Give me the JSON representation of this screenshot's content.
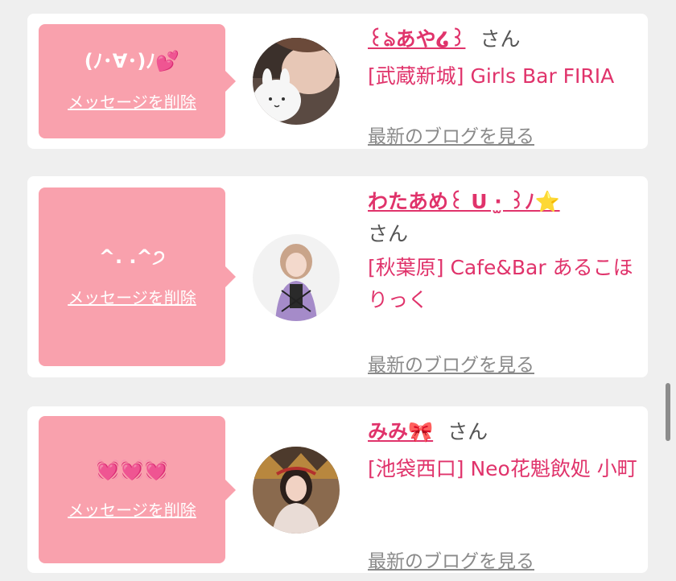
{
  "cards": [
    {
      "message": "(ﾉ･∀･)ﾉ💕",
      "delete_label": "メッセージを削除",
      "name": "꒰ঌあや໒꒱",
      "honorific": "さん",
      "shop": "[武蔵新城] Girls Bar FIRIA",
      "blog_label": "最新のブログを見る"
    },
    {
      "message": "^. .^੭",
      "delete_label": "メッセージを削除",
      "name": "わたあめ꒰ U ·̫ ꒱ﾉ⭐",
      "honorific": "さん",
      "shop": "[秋葉原] Cafe&Bar あるこほりっく",
      "blog_label": "最新のブログを見る"
    },
    {
      "message": "💓💓💓",
      "delete_label": "メッセージを削除",
      "name": "みみ🎀",
      "honorific": "さん",
      "shop": "[池袋西口] Neo花魁飲処 小町",
      "blog_label": "最新のブログを見る"
    }
  ],
  "colors": {
    "accent": "#e0336b",
    "bubble": "#f9a1ad",
    "background": "#efefef",
    "link_gray": "#8a8a8a"
  },
  "icons": [
    "profile-avatar-photo",
    "scrollbar-thumb"
  ]
}
